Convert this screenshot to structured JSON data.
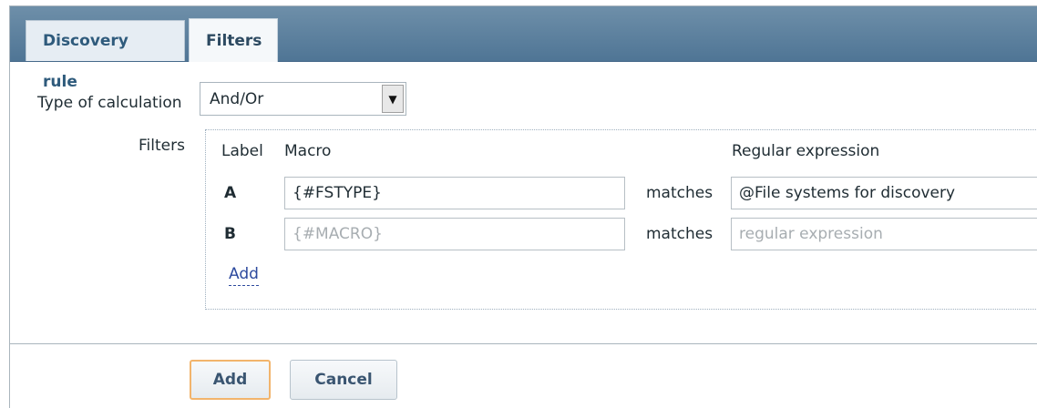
{
  "tabs": [
    {
      "label": "Discovery rule"
    },
    {
      "label": "Filters"
    }
  ],
  "form": {
    "type_label": "Type of calculation",
    "type_value": "And/Or",
    "filters_label": "Filters"
  },
  "filters": {
    "col_label": "Label",
    "col_macro": "Macro",
    "col_regex": "Regular expression",
    "rows": [
      {
        "label": "A",
        "macro_value": "{#FSTYPE}",
        "macro_placeholder": "",
        "operator": "matches",
        "regex_value": "@File systems for discovery",
        "regex_placeholder": ""
      },
      {
        "label": "B",
        "macro_value": "",
        "macro_placeholder": "{#MACRO}",
        "operator": "matches",
        "regex_value": "",
        "regex_placeholder": "regular expression"
      }
    ],
    "add_link": "Add"
  },
  "buttons": {
    "add": "Add",
    "cancel": "Cancel"
  },
  "icons": {
    "dropdown": "dropdown-arrow-icon"
  }
}
